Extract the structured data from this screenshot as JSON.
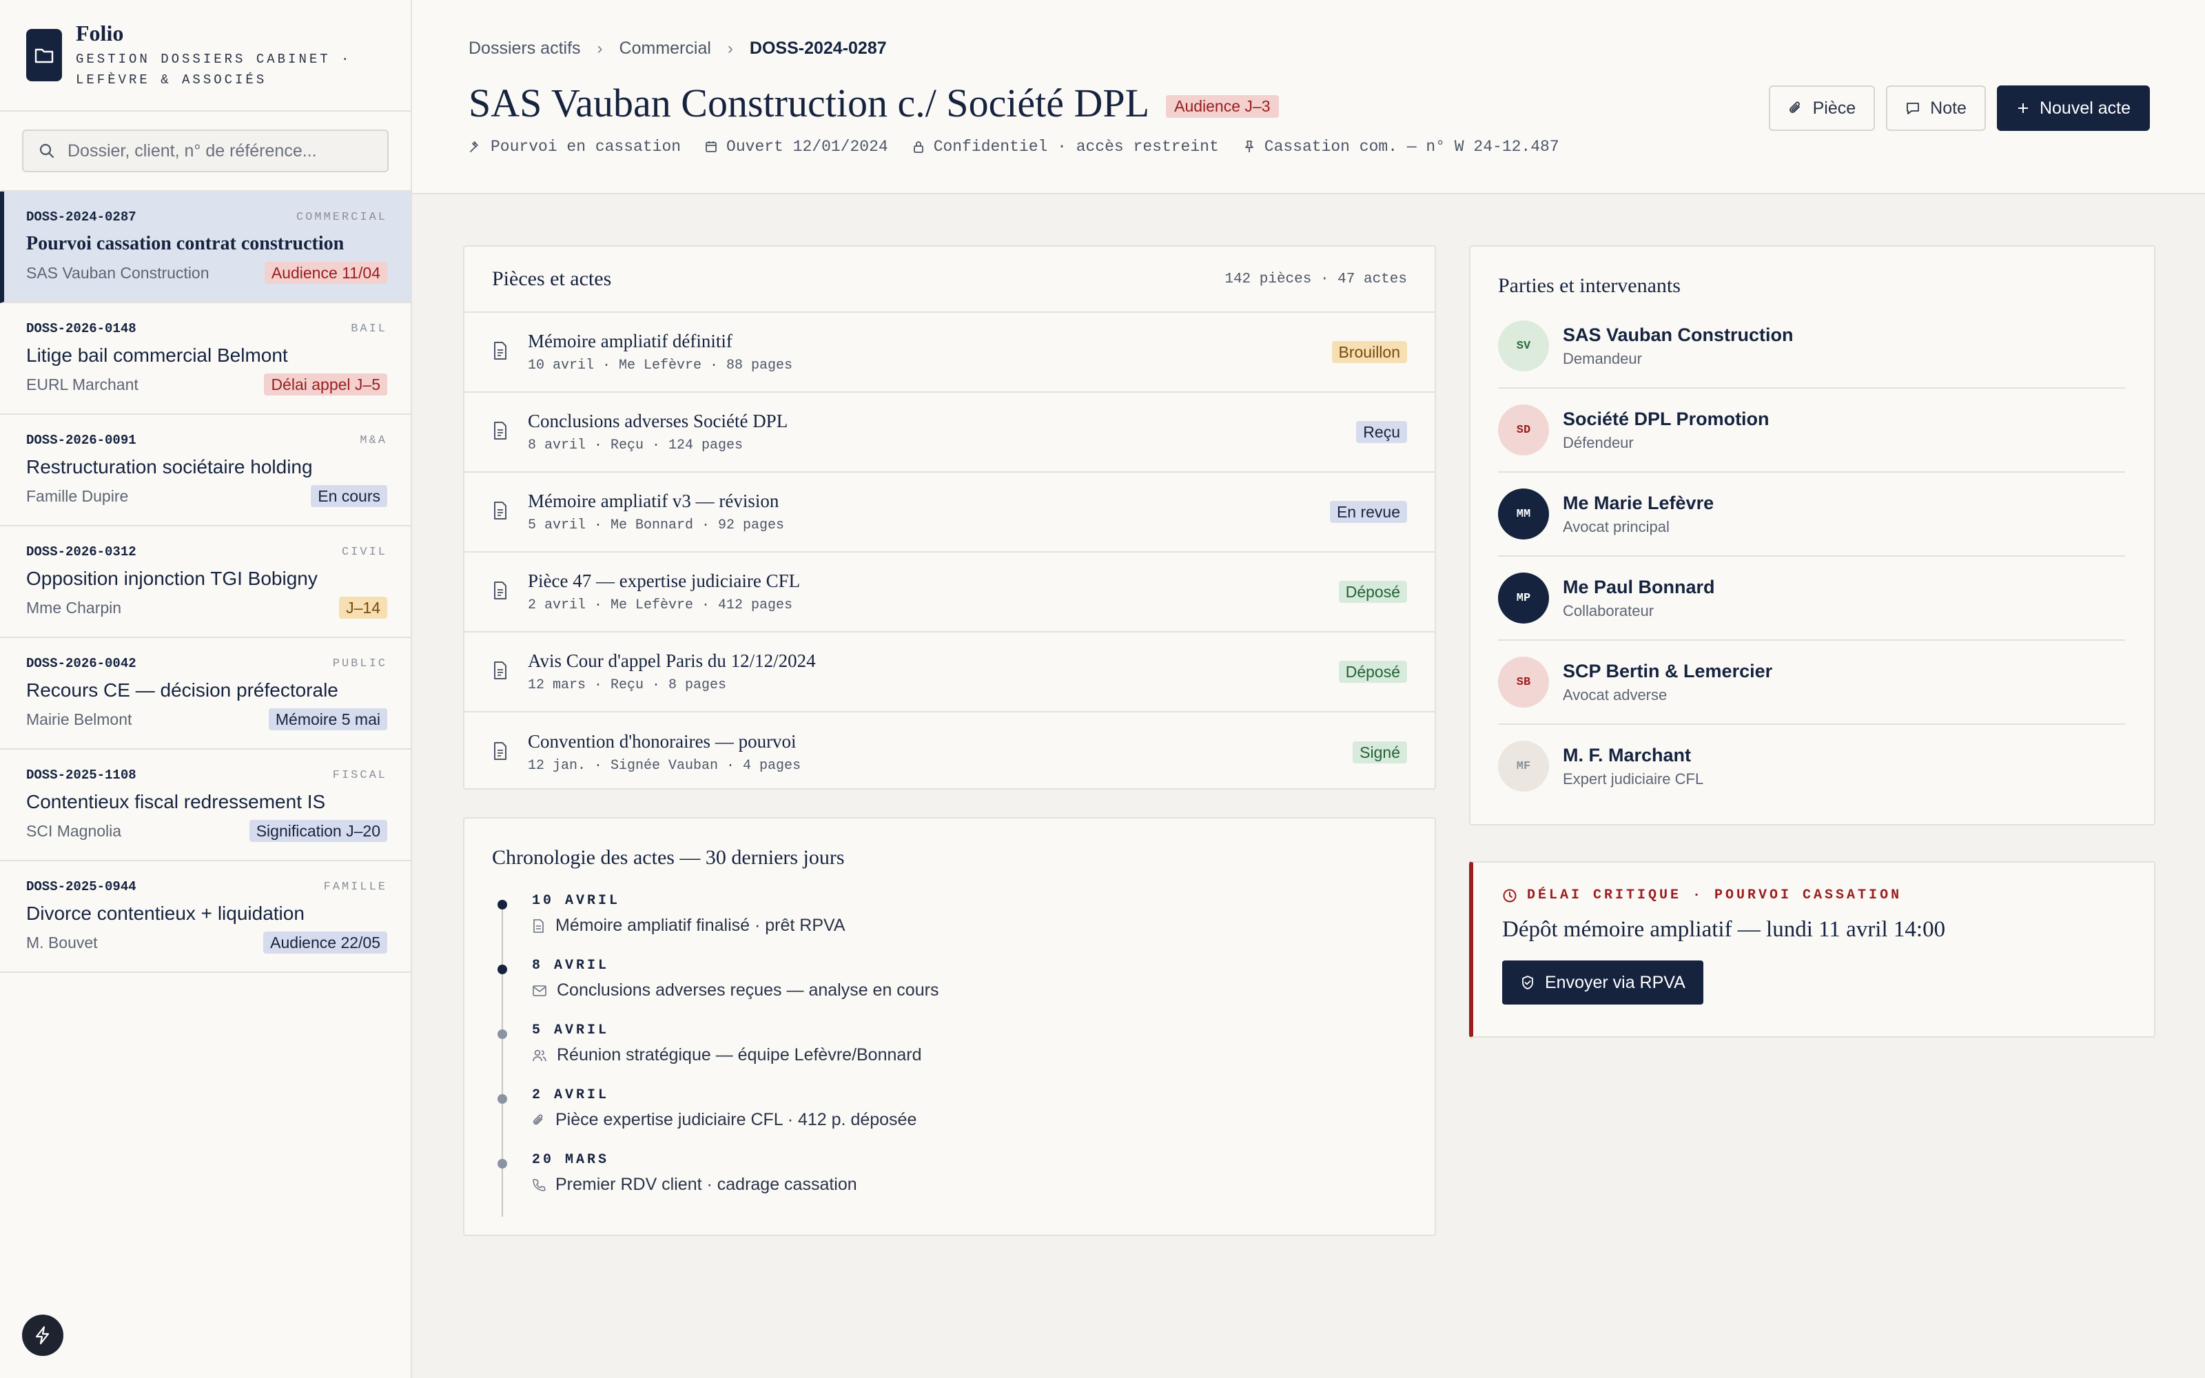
{
  "app": {
    "name": "Folio",
    "subtitle_line1": "GESTION DOSSIERS CABINET ·",
    "subtitle_line2": "LEFÈVRE & ASSOCIÉS"
  },
  "search": {
    "placeholder": "Dossier, client, n° de référence..."
  },
  "cases": [
    {
      "ref": "DOSS-2024-0287",
      "category": "COMMERCIAL",
      "title": "Pourvoi cassation contrat construction",
      "client": "SAS Vauban Construction",
      "tag": "Audience 11/04",
      "tag_color": "red",
      "active": true
    },
    {
      "ref": "DOSS-2026-0148",
      "category": "BAIL",
      "title": "Litige bail commercial Belmont",
      "client": "EURL Marchant",
      "tag": "Délai appel J–5",
      "tag_color": "red"
    },
    {
      "ref": "DOSS-2026-0091",
      "category": "M&A",
      "title": "Restructuration sociétaire holding",
      "client": "Famille Dupire",
      "tag": "En cours",
      "tag_color": "blue"
    },
    {
      "ref": "DOSS-2026-0312",
      "category": "CIVIL",
      "title": "Opposition injonction TGI Bobigny",
      "client": "Mme Charpin",
      "tag": "J–14",
      "tag_color": "amber"
    },
    {
      "ref": "DOSS-2026-0042",
      "category": "PUBLIC",
      "title": "Recours CE — décision préfectorale",
      "client": "Mairie Belmont",
      "tag": "Mémoire 5 mai",
      "tag_color": "blue"
    },
    {
      "ref": "DOSS-2025-1108",
      "category": "FISCAL",
      "title": "Contentieux fiscal redressement IS",
      "client": "SCI Magnolia",
      "tag": "Signification J–20",
      "tag_color": "blue"
    },
    {
      "ref": "DOSS-2025-0944",
      "category": "FAMILLE",
      "title": "Divorce contentieux + liquidation",
      "client": "M. Bouvet",
      "tag": "Audience 22/05",
      "tag_color": "blue"
    }
  ],
  "breadcrumb": {
    "root": "Dossiers actifs",
    "section": "Commercial",
    "current": "DOSS-2024-0287"
  },
  "header": {
    "title": "SAS Vauban Construction c./ Société DPL",
    "badge": "Audience J–3",
    "meta": {
      "type": "Pourvoi en cassation",
      "opened": "Ouvert 12/01/2024",
      "access": "Confidentiel · accès restreint",
      "court": "Cassation com. — n° W 24-12.487"
    }
  },
  "actions": {
    "piece": "Pièce",
    "note": "Note",
    "new_act": "Nouvel acte"
  },
  "pieces": {
    "title": "Pièces et actes",
    "count": "142 pièces · 47 actes",
    "items": [
      {
        "title": "Mémoire ampliatif définitif",
        "meta": "10 avril · Me Lefèvre · 88 pages",
        "status": "Brouillon",
        "status_color": "amber"
      },
      {
        "title": "Conclusions adverses Société DPL",
        "meta": "8 avril · Reçu · 124 pages",
        "status": "Reçu",
        "status_color": "blue"
      },
      {
        "title": "Mémoire ampliatif v3 — révision",
        "meta": "5 avril · Me Bonnard · 92 pages",
        "status": "En revue",
        "status_color": "blue"
      },
      {
        "title": "Pièce 47 — expertise judiciaire CFL",
        "meta": "2 avril · Me Lefèvre · 412 pages",
        "status": "Déposé",
        "status_color": "green"
      },
      {
        "title": "Avis Cour d'appel Paris du 12/12/2024",
        "meta": "12 mars · Reçu · 8 pages",
        "status": "Déposé",
        "status_color": "green"
      },
      {
        "title": "Convention d'honoraires — pourvoi",
        "meta": "12 jan. · Signée Vauban · 4 pages",
        "status": "Signé",
        "status_color": "green"
      }
    ]
  },
  "chronology": {
    "title": "Chronologie des actes — 30 derniers jours",
    "items": [
      {
        "date": "10 AVRIL",
        "icon": "document-icon",
        "text": "Mémoire ampliatif finalisé · prêt RPVA",
        "recent": true
      },
      {
        "date": "8 AVRIL",
        "icon": "mail-icon",
        "text": "Conclusions adverses reçues — analyse en cours",
        "recent": true
      },
      {
        "date": "5 AVRIL",
        "icon": "users-icon",
        "text": "Réunion stratégique — équipe Lefèvre/Bonnard",
        "recent": false
      },
      {
        "date": "2 AVRIL",
        "icon": "paperclip-icon",
        "text": "Pièce expertise judiciaire CFL · 412 p. déposée",
        "recent": false
      },
      {
        "date": "20 MARS",
        "icon": "phone-icon",
        "text": "Premier RDV client · cadrage cassation",
        "recent": false
      }
    ]
  },
  "parties": {
    "title": "Parties et intervenants",
    "items": [
      {
        "initials": "SV",
        "name": "SAS Vauban Construction",
        "role": "Demandeur",
        "bg": "#dcebdc",
        "fg": "#2f6b3d"
      },
      {
        "initials": "SD",
        "name": "Société DPL Promotion",
        "role": "Défendeur",
        "bg": "#f2d6d3",
        "fg": "#9b1d1d"
      },
      {
        "initials": "MM",
        "name": "Me Marie Lefèvre",
        "role": "Avocat principal",
        "bg": "#16233f",
        "fg": "#ffffff"
      },
      {
        "initials": "MP",
        "name": "Me Paul Bonnard",
        "role": "Collaborateur",
        "bg": "#16233f",
        "fg": "#ffffff"
      },
      {
        "initials": "SB",
        "name": "SCP Bertin & Lemercier",
        "role": "Avocat adverse",
        "bg": "#f2d6d3",
        "fg": "#9b1d1d"
      },
      {
        "initials": "MF",
        "name": "M. F. Marchant",
        "role": "Expert judiciaire CFL",
        "bg": "#ebe7e0",
        "fg": "#8b8f9a"
      }
    ]
  },
  "alert": {
    "label": "DÉLAI CRITIQUE · POURVOI CASSATION",
    "title": "Dépôt mémoire ampliatif — lundi 11 avril 14:00",
    "button": "Envoyer via RPVA"
  },
  "colors": {
    "navy": "#16233f",
    "danger": "#9b1d1d",
    "background": "#f3f2ef"
  }
}
